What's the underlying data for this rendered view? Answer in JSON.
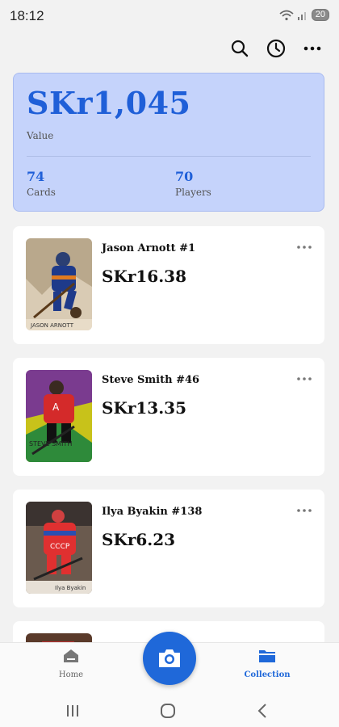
{
  "status": {
    "time": "18:12",
    "battery": "20"
  },
  "summary": {
    "value": "SKr1,045",
    "value_label": "Value",
    "cards_count": "74",
    "cards_label": "Cards",
    "players_count": "70",
    "players_label": "Players"
  },
  "cards": [
    {
      "name": "Jason Arnott #1",
      "price": "SKr16.38",
      "image_caption": "JASON ARNOTT"
    },
    {
      "name": "Steve Smith #46",
      "price": "SKr13.35",
      "image_caption": "STEVE SMITH"
    },
    {
      "name": "Ilya Byakin #138",
      "price": "SKr6.23",
      "image_caption": "Ilya Byakin"
    }
  ],
  "nav": {
    "home_label": "Home",
    "collection_label": "Collection"
  },
  "colors": {
    "accent": "#1f68d9",
    "summary_bg": "#c5d3fb",
    "page_bg": "#f2f2f2"
  },
  "icons": {
    "topbar": [
      "search-icon",
      "history-icon",
      "more-icon"
    ],
    "nav": [
      "home-icon",
      "camera-icon",
      "folder-icon"
    ],
    "system": [
      "recents-icon",
      "home-circle-icon",
      "back-icon"
    ]
  }
}
